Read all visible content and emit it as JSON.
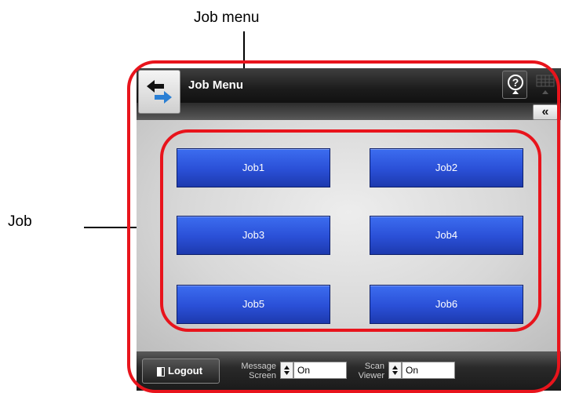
{
  "callouts": {
    "job_menu": "Job menu",
    "job": "Job"
  },
  "header": {
    "title": "Job Menu",
    "back_icon": "back-arrows-icon",
    "help_icon": "help-icon",
    "keyboard_icon": "keyboard-icon",
    "collapse_label": "«"
  },
  "jobs": [
    "Job1",
    "Job2",
    "Job3",
    "Job4",
    "Job5",
    "Job6"
  ],
  "footer": {
    "logout_label": "Logout",
    "message_screen_label_1": "Message",
    "message_screen_label_2": "Screen",
    "message_screen_value": "On",
    "scan_viewer_label_1": "Scan",
    "scan_viewer_label_2": "Viewer",
    "scan_viewer_value": "On"
  },
  "colors": {
    "highlight": "#e8141c",
    "job_button": "#2a4fd6"
  }
}
